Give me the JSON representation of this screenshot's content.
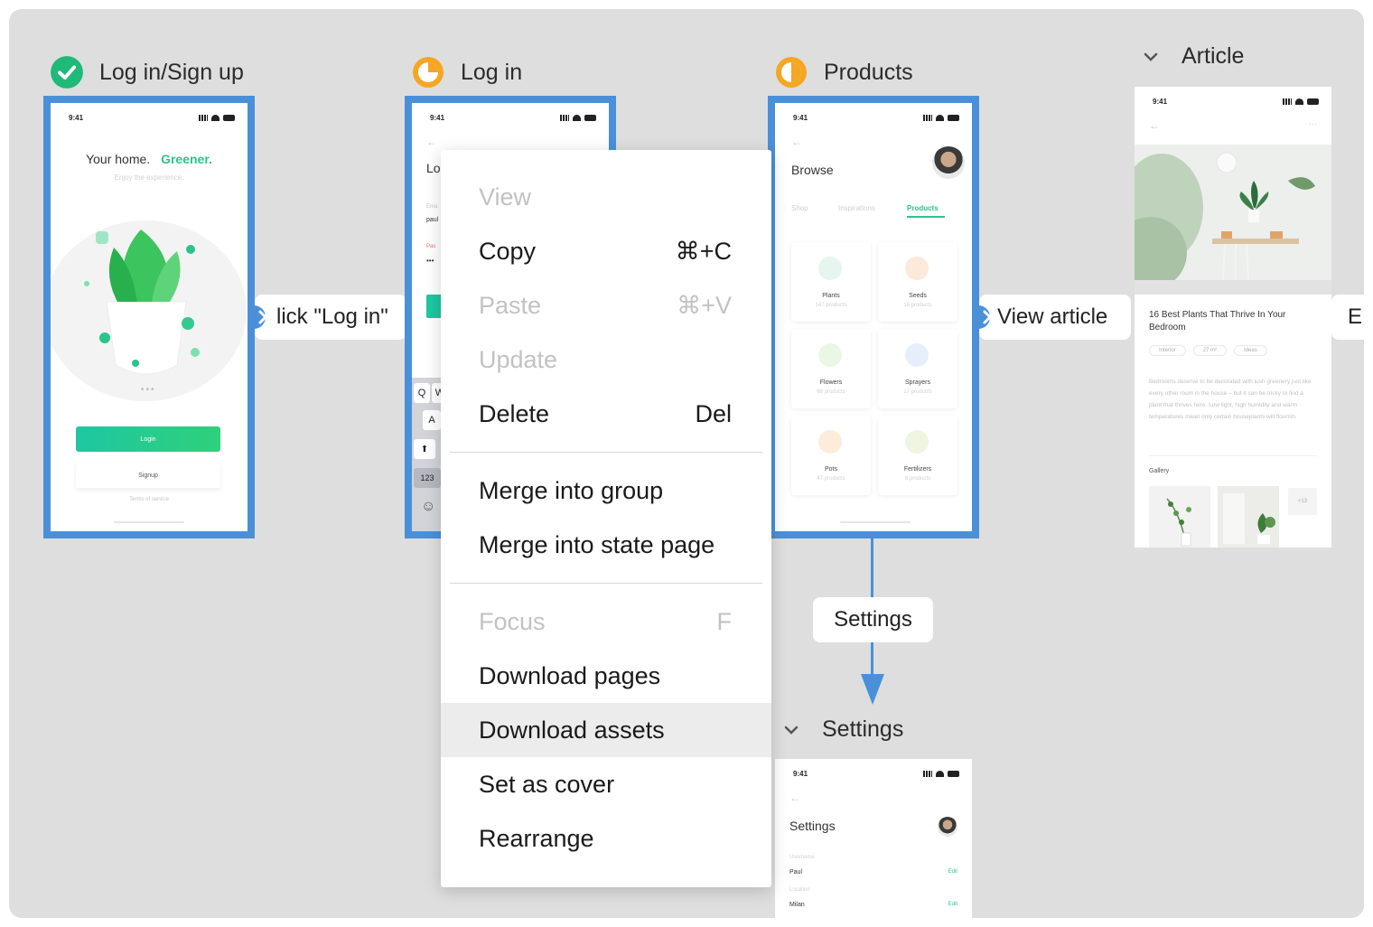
{
  "screens": {
    "login_signup": {
      "title": "Log in/Sign up",
      "status": "done",
      "time": "9:41",
      "headline": "Your home.",
      "headline_accent": "Greener.",
      "tagline": "Enjoy the experience.",
      "login_button": "Login",
      "signup_button": "Signup",
      "terms": "Terms of service"
    },
    "log_in": {
      "title": "Log in",
      "status": "in-progress-quarter",
      "time": "9:41",
      "heading_partial": "Lo",
      "email_label_partial": "Ema",
      "email_value_partial": "paul",
      "password_label_partial": "Pas",
      "password_dots": "•••",
      "keys": [
        "Q",
        "W",
        "A",
        "⬆",
        "123",
        "☺"
      ]
    },
    "products": {
      "title": "Products",
      "status": "in-progress-half",
      "time": "9:41",
      "back": "←",
      "heading": "Browse",
      "tabs": [
        "Shop",
        "Inspirations",
        "Products"
      ],
      "active_tab": "Products",
      "categories": [
        {
          "name": "Plants",
          "count": "147 products"
        },
        {
          "name": "Seeds",
          "count": "16 products"
        },
        {
          "name": "Flowers",
          "count": "68 products"
        },
        {
          "name": "Sprayers",
          "count": "17 products"
        },
        {
          "name": "Pots",
          "count": "47 products"
        },
        {
          "name": "Fertilizers",
          "count": "6 products"
        }
      ]
    },
    "article": {
      "title": "Article",
      "time": "9:41",
      "back": "←",
      "more": "···",
      "heading": "16 Best Plants That Thrive In Your Bedroom",
      "tags": [
        "Interior",
        "27 m²",
        "Ideas"
      ],
      "body": "Bedrooms deserve to be decorated with lush greenery just like every other room in the house – but it can be tricky to find a plant that thrives here. Low light, high humidity and warm temperatures mean only certain houseplants will flourish.",
      "gallery_label": "Gallery",
      "gallery_more": "+13"
    },
    "settings": {
      "title": "Settings",
      "time": "9:41",
      "back": "←",
      "heading": "Settings",
      "fields": [
        {
          "label": "Username",
          "value": "Paul",
          "action": "Edit"
        },
        {
          "label": "Location",
          "value": "Milan",
          "action": "Edit"
        }
      ]
    }
  },
  "connections": {
    "click_log_in": "lick \"Log in\"",
    "view_article": "View article",
    "explore_partial": "E",
    "settings": "Settings"
  },
  "context_menu": {
    "items": [
      {
        "label": "View",
        "shortcut": "",
        "disabled": true
      },
      {
        "label": "Copy",
        "shortcut": "⌘+C",
        "disabled": false
      },
      {
        "label": "Paste",
        "shortcut": "⌘+V",
        "disabled": true
      },
      {
        "label": "Update",
        "shortcut": "",
        "disabled": true
      },
      {
        "label": "Delete",
        "shortcut": "Del",
        "disabled": false
      },
      {
        "label": "Merge into group",
        "shortcut": "",
        "disabled": false
      },
      {
        "label": "Merge into state page",
        "shortcut": "",
        "disabled": false
      },
      {
        "label": "Focus",
        "shortcut": "F",
        "disabled": true
      },
      {
        "label": "Download pages",
        "shortcut": "",
        "disabled": false
      },
      {
        "label": "Download assets",
        "shortcut": "",
        "disabled": false,
        "hovered": true
      },
      {
        "label": "Set as cover",
        "shortcut": "",
        "disabled": false
      },
      {
        "label": "Rearrange",
        "shortcut": "",
        "disabled": false
      }
    ]
  },
  "colors": {
    "selection": "#4a90d9",
    "brand_green": "#2bc48a",
    "status_done": "#1fb978",
    "status_progress": "#f5a623",
    "canvas": "#dedede"
  }
}
